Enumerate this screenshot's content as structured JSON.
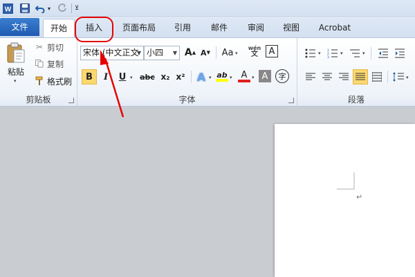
{
  "qat": {
    "app_icon": "word-icon",
    "save_icon": "save-icon",
    "undo_icon": "undo-icon",
    "redo_icon": "redo-icon",
    "customize_icon": "customize-qat-icon"
  },
  "tabs": [
    {
      "label": "文件"
    },
    {
      "label": "开始"
    },
    {
      "label": "插入"
    },
    {
      "label": "页面布局"
    },
    {
      "label": "引用"
    },
    {
      "label": "邮件"
    },
    {
      "label": "审阅"
    },
    {
      "label": "视图"
    },
    {
      "label": "Acrobat"
    }
  ],
  "clipboard": {
    "group_label": "剪贴板",
    "paste_label": "粘贴",
    "cut_label": "剪切",
    "copy_label": "复制",
    "format_painter_label": "格式刷"
  },
  "font": {
    "group_label": "字体",
    "font_name": "宋体 (中文正文",
    "font_size": "小四",
    "grow_label": "A",
    "shrink_label": "A",
    "change_case_label": "Aa",
    "phonetic_label": "wén",
    "border_label": "A",
    "bold_label": "B",
    "italic_label": "I",
    "underline_label": "U",
    "strike_label": "abc",
    "subscript_label": "x₂",
    "superscript_label": "x²",
    "effects_label": "A",
    "highlight_label": "ab",
    "font_color_label": "A",
    "char_shading_label": "A",
    "enclose_label": "字"
  },
  "paragraph": {
    "group_label": "段落"
  },
  "colors": {
    "highlight_red": "#e60000",
    "file_tab": "#2a6bc2",
    "active_align": "#fbd86f"
  }
}
